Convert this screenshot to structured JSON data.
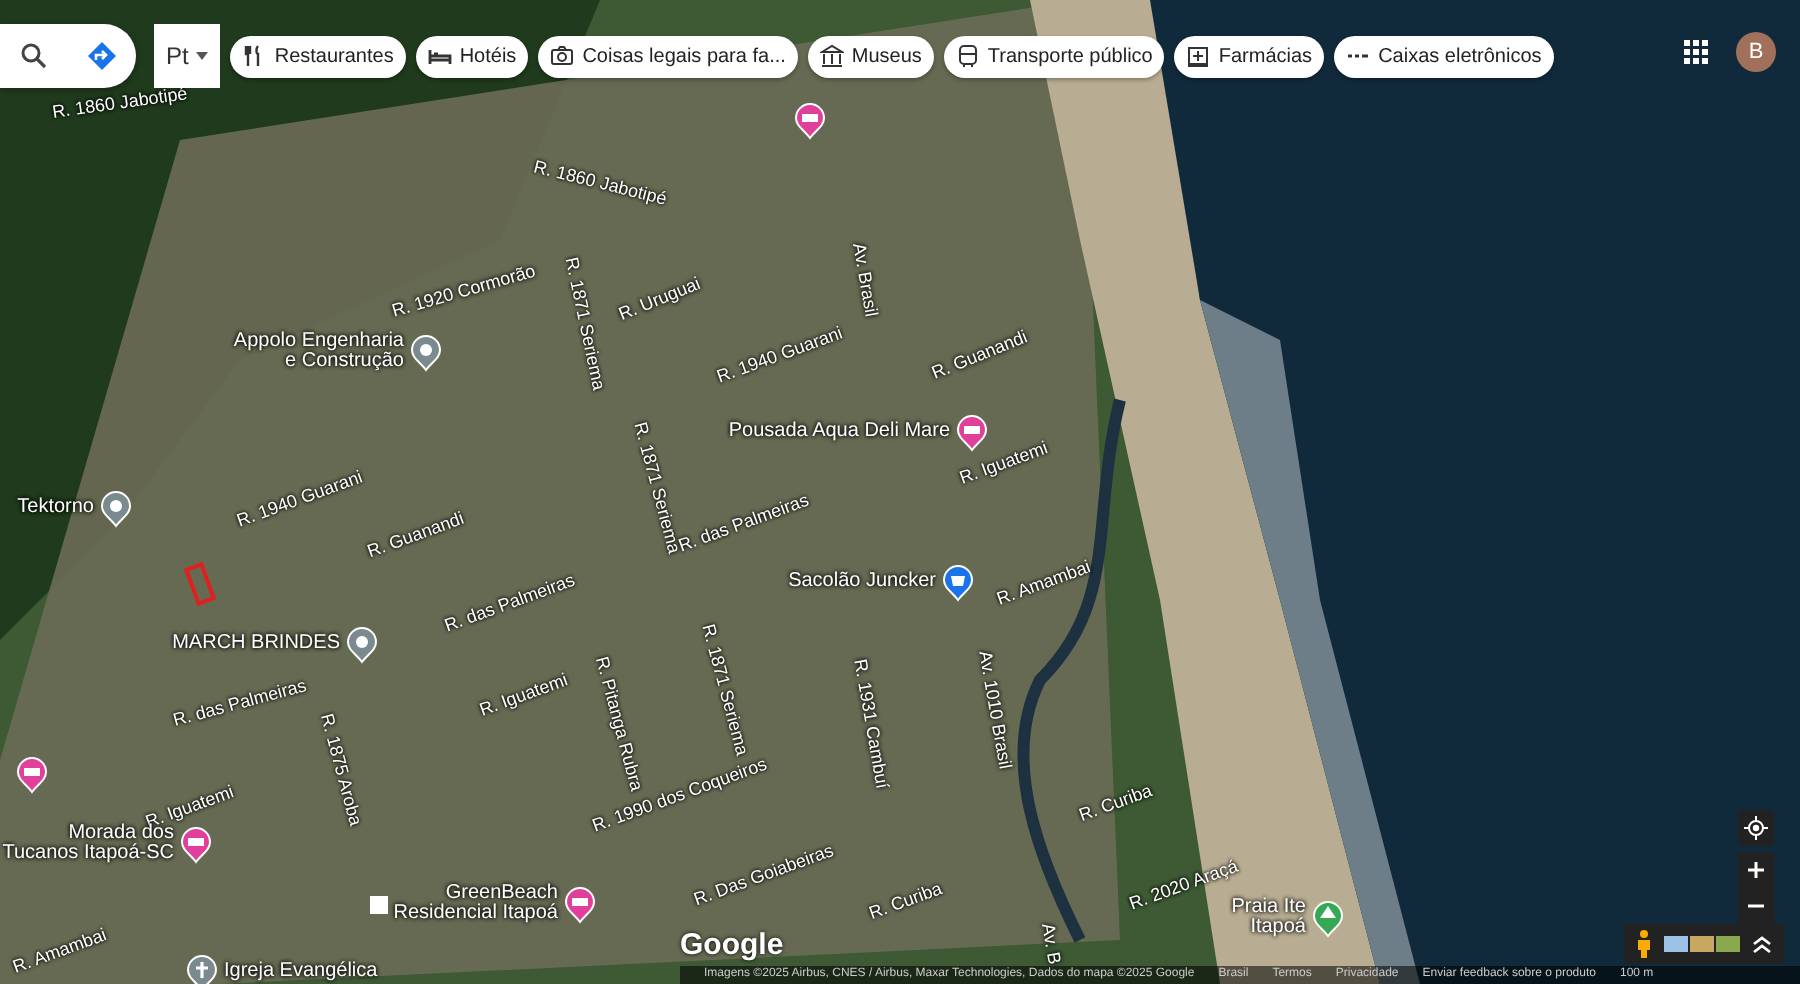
{
  "layer_selector": {
    "label": "Pt"
  },
  "category_chips": [
    {
      "kind": "restaurant",
      "label": "Restaurantes"
    },
    {
      "kind": "hotel",
      "label": "Hotéis"
    },
    {
      "kind": "camera",
      "label": "Coisas legais para fa..."
    },
    {
      "kind": "museum",
      "label": "Museus"
    },
    {
      "kind": "transit",
      "label": "Transporte público"
    },
    {
      "kind": "pharmacy",
      "label": "Farmácias"
    },
    {
      "kind": "atm",
      "label": "Caixas eletrônicos"
    }
  ],
  "account": {
    "initial": "B"
  },
  "streets": [
    {
      "name": "R. 1860 Jabotipé"
    },
    {
      "name": "R. 1860 Jabotipé"
    },
    {
      "name": "R. 1920 Cormorão"
    },
    {
      "name": "R. Uruguai"
    },
    {
      "name": "R. 1871 Seriema"
    },
    {
      "name": "Av. Brasil"
    },
    {
      "name": "R. 1940 Guarani"
    },
    {
      "name": "R. 1940 Guarani"
    },
    {
      "name": "R. Guanandi"
    },
    {
      "name": "R. Guanandi"
    },
    {
      "name": "R. 1871 Seriema"
    },
    {
      "name": "R. das Palmeiras"
    },
    {
      "name": "R. das Palmeiras"
    },
    {
      "name": "R. das Palmeiras"
    },
    {
      "name": "R. Iguatemi"
    },
    {
      "name": "R. Iguatemi"
    },
    {
      "name": "R. Iguatemi"
    },
    {
      "name": "R. Amambai"
    },
    {
      "name": "R. Amambai"
    },
    {
      "name": "R. 1871 Seriema"
    },
    {
      "name": "R. 1931 Cambuí"
    },
    {
      "name": "Av. 1010 Brasil"
    },
    {
      "name": "R. 1990 dos Coqueiros"
    },
    {
      "name": "R. Pitanga Rubra"
    },
    {
      "name": "R. 1875 Aroba"
    },
    {
      "name": "R. Das Goiabeiras"
    },
    {
      "name": "R. Curiba"
    },
    {
      "name": "R. Curiba"
    },
    {
      "name": "R. 2020 Araçá"
    },
    {
      "name": "Av. B"
    }
  ],
  "places": [
    {
      "kind": "service",
      "lines": [
        "Appolo Engenharia",
        "e Construção"
      ]
    },
    {
      "kind": "service",
      "lines": [
        "Tektorno"
      ]
    },
    {
      "kind": "service",
      "lines": [
        "MARCH BRINDES"
      ]
    },
    {
      "kind": "lodging",
      "lines": [
        "Pousada Aqua Deli Mare"
      ]
    },
    {
      "kind": "shop",
      "lines": [
        "Sacolão Juncker"
      ]
    },
    {
      "kind": "lodging",
      "lines": [
        "Morada dos",
        "Tucanos Itapoá-SC"
      ]
    },
    {
      "kind": "lodging",
      "lines": [
        "GreenBeach",
        "Residencial Itapoá"
      ]
    },
    {
      "kind": "park",
      "lines": [
        "Praia Ite",
        "Itapoá"
      ]
    },
    {
      "kind": "church",
      "lines": [
        "Igreja Evangélica"
      ]
    },
    {
      "kind": "lodging"
    },
    {
      "kind": "lodging"
    }
  ],
  "logo": "Google",
  "footer": {
    "imagery": "Imagens ©2025 Airbus, CNES / Airbus, Maxar Technologies, Dados do mapa ©2025 Google",
    "links": [
      "Brasil",
      "Termos",
      "Privacidade",
      "Enviar feedback sobre o produto"
    ],
    "scale": "100 m"
  }
}
